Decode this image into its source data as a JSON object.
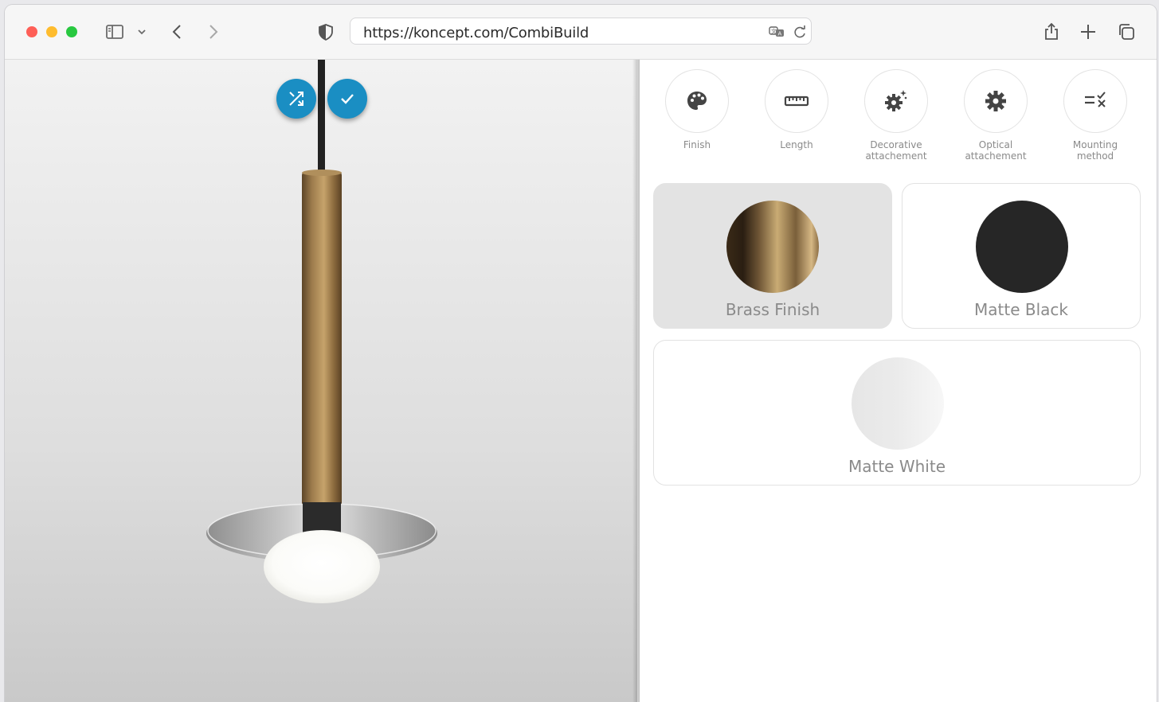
{
  "browser": {
    "url": "https://koncept.com/CombiBuild"
  },
  "viewer": {
    "randomize_label": "shuffle",
    "confirm_label": "confirm"
  },
  "categories": [
    {
      "label_line1": "Finish",
      "label_line2": "",
      "icon": "palette-icon"
    },
    {
      "label_line1": "Length",
      "label_line2": "",
      "icon": "ruler-icon"
    },
    {
      "label_line1": "Decorative",
      "label_line2": "attachement",
      "icon": "gear-sparkle-icon"
    },
    {
      "label_line1": "Optical",
      "label_line2": "attachement",
      "icon": "gear-icon"
    },
    {
      "label_line1": "Mounting",
      "label_line2": "method",
      "icon": "checklist-icon"
    }
  ],
  "options": [
    {
      "label": "Brass Finish",
      "selected": true,
      "color": "#a8875a"
    },
    {
      "label": "Matte Black",
      "selected": false,
      "color": "#262626"
    },
    {
      "label": "Matte White",
      "selected": false,
      "color": "#eeeeee"
    }
  ],
  "colors": {
    "accent": "#1a8ec3"
  }
}
